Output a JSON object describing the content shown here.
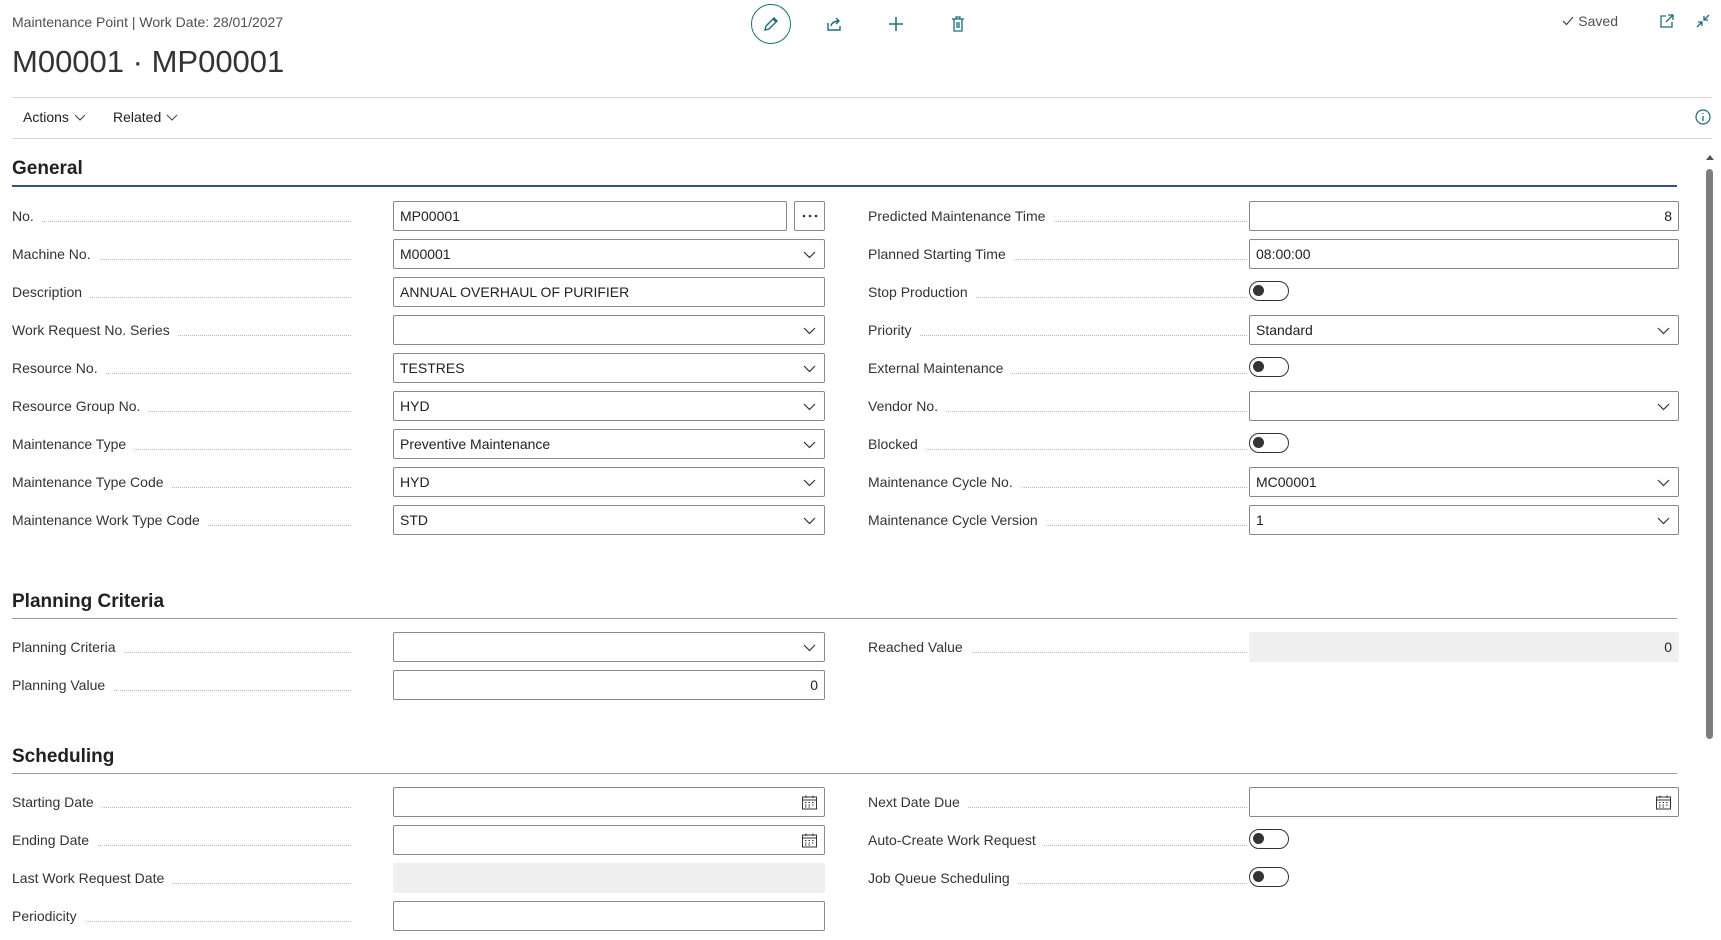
{
  "header": {
    "caption": "Maintenance Point | Work Date: 28/01/2027",
    "title": "M00001 · MP00001",
    "saved_label": "Saved"
  },
  "toolbar_icons": [
    "edit-icon",
    "share-icon",
    "new-icon",
    "delete-icon",
    "open-new-window-icon",
    "collapse-icon"
  ],
  "actionbar": {
    "actions_label": "Actions",
    "related_label": "Related"
  },
  "general": {
    "title": "General",
    "left": [
      {
        "label": "No.",
        "value": "MP00001",
        "kind": "assist"
      },
      {
        "label": "Machine No.",
        "value": "M00001",
        "kind": "dropdown"
      },
      {
        "label": "Description",
        "value": "ANNUAL OVERHAUL OF PURIFIER",
        "kind": "text"
      },
      {
        "label": "Work Request No. Series",
        "value": "",
        "kind": "dropdown"
      },
      {
        "label": "Resource No.",
        "value": "TESTRES",
        "kind": "dropdown"
      },
      {
        "label": "Resource Group No.",
        "value": "HYD",
        "kind": "dropdown"
      },
      {
        "label": "Maintenance Type",
        "value": "Preventive Maintenance",
        "kind": "dropdown"
      },
      {
        "label": "Maintenance Type Code",
        "value": "HYD",
        "kind": "dropdown"
      },
      {
        "label": "Maintenance Work Type Code",
        "value": "STD",
        "kind": "dropdown"
      }
    ],
    "right": [
      {
        "label": "Predicted Maintenance Time",
        "value": "8",
        "kind": "number"
      },
      {
        "label": "Planned Starting Time",
        "value": "08:00:00",
        "kind": "text"
      },
      {
        "label": "Stop Production",
        "value": "off",
        "kind": "toggle"
      },
      {
        "label": "Priority",
        "value": "Standard",
        "kind": "dropdown"
      },
      {
        "label": "External Maintenance",
        "value": "off",
        "kind": "toggle"
      },
      {
        "label": "Vendor No.",
        "value": "",
        "kind": "dropdown"
      },
      {
        "label": "Blocked",
        "value": "off",
        "kind": "toggle"
      },
      {
        "label": "Maintenance Cycle No.",
        "value": "MC00001",
        "kind": "dropdown"
      },
      {
        "label": "Maintenance Cycle Version",
        "value": "1",
        "kind": "dropdown"
      }
    ]
  },
  "planning": {
    "title": "Planning Criteria",
    "left": [
      {
        "label": "Planning Criteria",
        "value": "",
        "kind": "dropdown"
      },
      {
        "label": "Planning Value",
        "value": "0",
        "kind": "number"
      }
    ],
    "right": [
      {
        "label": "Reached Value",
        "value": "0",
        "kind": "readonly-number"
      }
    ]
  },
  "scheduling": {
    "title": "Scheduling",
    "left": [
      {
        "label": "Starting Date",
        "value": "",
        "kind": "date"
      },
      {
        "label": "Ending Date",
        "value": "",
        "kind": "date"
      },
      {
        "label": "Last Work Request Date",
        "value": "",
        "kind": "readonly"
      },
      {
        "label": "Periodicity",
        "value": "",
        "kind": "text"
      }
    ],
    "right": [
      {
        "label": "Next Date Due",
        "value": "",
        "kind": "date"
      },
      {
        "label": "Auto-Create Work Request",
        "value": "off",
        "kind": "toggle"
      },
      {
        "label": "Job Queue Scheduling",
        "value": "off",
        "kind": "toggle"
      }
    ]
  }
}
